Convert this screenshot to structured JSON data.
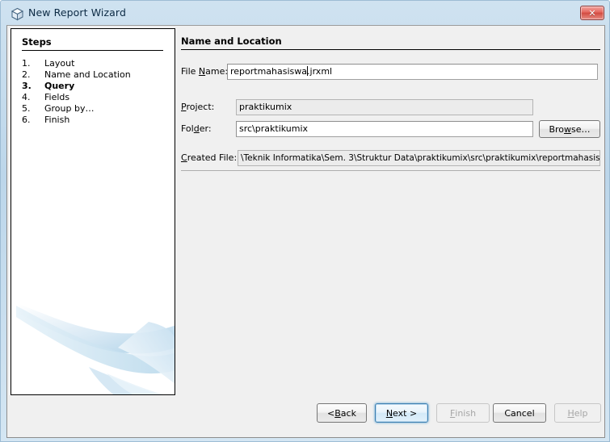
{
  "window": {
    "title": "New Report Wizard",
    "icon": "cube-icon",
    "close_label": "✕"
  },
  "steps": {
    "heading": "Steps",
    "items": [
      {
        "num": "1.",
        "label": "Layout",
        "current": false
      },
      {
        "num": "2.",
        "label": "Name and Location",
        "current": false
      },
      {
        "num": "3.",
        "label": "Query",
        "current": true
      },
      {
        "num": "4.",
        "label": "Fields",
        "current": false
      },
      {
        "num": "5.",
        "label": "Group by…",
        "current": false
      },
      {
        "num": "6.",
        "label": "Finish",
        "current": false
      }
    ]
  },
  "content": {
    "section_title": "Name and Location",
    "fields": {
      "file_name": {
        "label_pre": "File ",
        "label_mn": "N",
        "label_post": "ame:",
        "value_pre": "reportmahasiswa",
        "value_post": ".jrxml"
      },
      "project": {
        "label_pre": "",
        "label_mn": "P",
        "label_post": "roject:",
        "value": "praktikumix"
      },
      "folder": {
        "label_pre": "Fol",
        "label_mn": "d",
        "label_post": "er:",
        "value": "src\\praktikumix"
      },
      "created_file": {
        "label_pre": "",
        "label_mn": "C",
        "label_post": "reated File:",
        "value": "\\Teknik Informatika\\Sem. 3\\Struktur Data\\praktikumix\\src\\praktikumix\\reportmahasiswa.jrxml"
      }
    },
    "browse_button": {
      "pre": "Bro",
      "mn": "w",
      "post": "se…"
    }
  },
  "buttons": {
    "back": {
      "pre": "< ",
      "mn": "B",
      "post": "ack",
      "disabled": false,
      "default": false
    },
    "next": {
      "pre": "",
      "mn": "N",
      "post": "ext >",
      "disabled": false,
      "default": true
    },
    "finish": {
      "pre": "",
      "mn": "F",
      "post": "inish",
      "disabled": true,
      "default": false
    },
    "cancel": {
      "pre": "",
      "mn": "",
      "post": "Cancel",
      "disabled": false,
      "default": false
    },
    "help": {
      "pre": "",
      "mn": "H",
      "post": "elp",
      "disabled": true,
      "default": false
    }
  },
  "colors": {
    "title_gradient_top": "#cfe2f0",
    "panel_bg": "#f0f0f0",
    "steps_bg": "#ffffff",
    "close_red": "#d24a40",
    "accent_blue": "#3c7fb1",
    "watermark_blue": "#bcd9ea"
  }
}
